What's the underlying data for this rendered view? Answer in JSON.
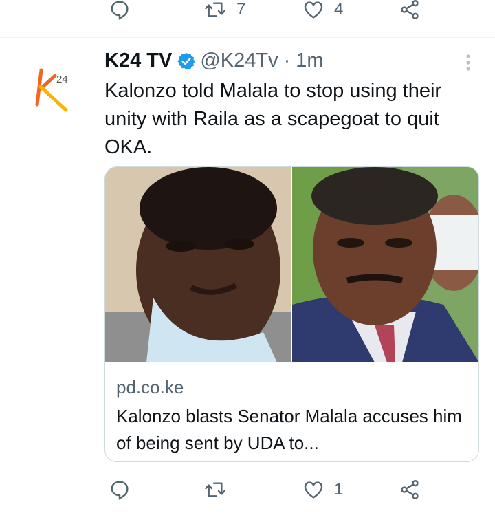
{
  "previous_tweet": {
    "retweets": "7",
    "likes": "4"
  },
  "tweet": {
    "author_name": "K24 TV",
    "handle": "@K24Tv",
    "separator": "·",
    "time": "1m",
    "avatar_text": "24",
    "text": "Kalonzo told Malala to stop using their unity with Raila as a scapegoat to quit OKA.",
    "card": {
      "domain": "pd.co.ke",
      "title": "Kalonzo blasts Senator Malala accuses him of being sent by UDA to..."
    },
    "retweets": "",
    "likes": "1"
  },
  "icons": {
    "reply": "reply-icon",
    "retweet": "retweet-icon",
    "like": "heart-icon",
    "share": "share-icon",
    "verified": "verified-badge-icon",
    "more": "more-options-icon"
  },
  "colors": {
    "text": "#0f1419",
    "secondary": "#536471",
    "verified": "#1d9bf0",
    "divider": "#eff3f4",
    "logo_orange": "#f26522",
    "logo_yellow": "#f7b500"
  }
}
